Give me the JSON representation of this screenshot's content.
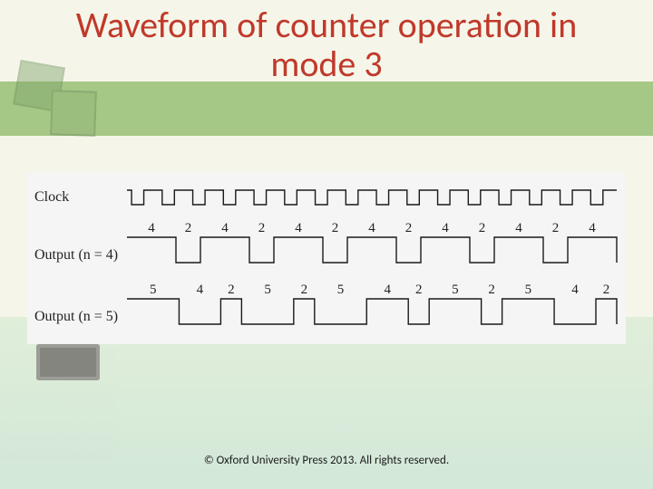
{
  "title_line1": "Waveform of counter operation in",
  "title_line2": "mode 3",
  "copyright": "© Oxford University Press 2013. All rights reserved.",
  "labels": {
    "clock": "Clock",
    "out4": "Output (n = 4)",
    "out5": "Output (n = 5)"
  },
  "chart_data": {
    "type": "timing-diagram",
    "signals": [
      {
        "name": "Clock",
        "kind": "clock",
        "pulses": 16
      },
      {
        "name": "Output (n = 4)",
        "kind": "square",
        "period_counts": [
          4,
          2,
          4,
          2,
          4,
          2,
          4,
          2,
          4,
          2,
          4,
          2,
          4
        ],
        "numbers": [
          "4",
          "2",
          "4",
          "2",
          "4",
          "2",
          "4",
          "2",
          "4",
          "2",
          "4",
          "2",
          "4"
        ]
      },
      {
        "name": "Output (n = 5)",
        "kind": "square",
        "period_counts": [
          5,
          4,
          2,
          5,
          2,
          5,
          4,
          2,
          5,
          2,
          5,
          4,
          2
        ],
        "numbers": [
          "5",
          "4",
          "2",
          "5",
          "2",
          "5",
          "4",
          "2",
          "5",
          "2",
          "5",
          "4",
          "2"
        ]
      }
    ]
  }
}
